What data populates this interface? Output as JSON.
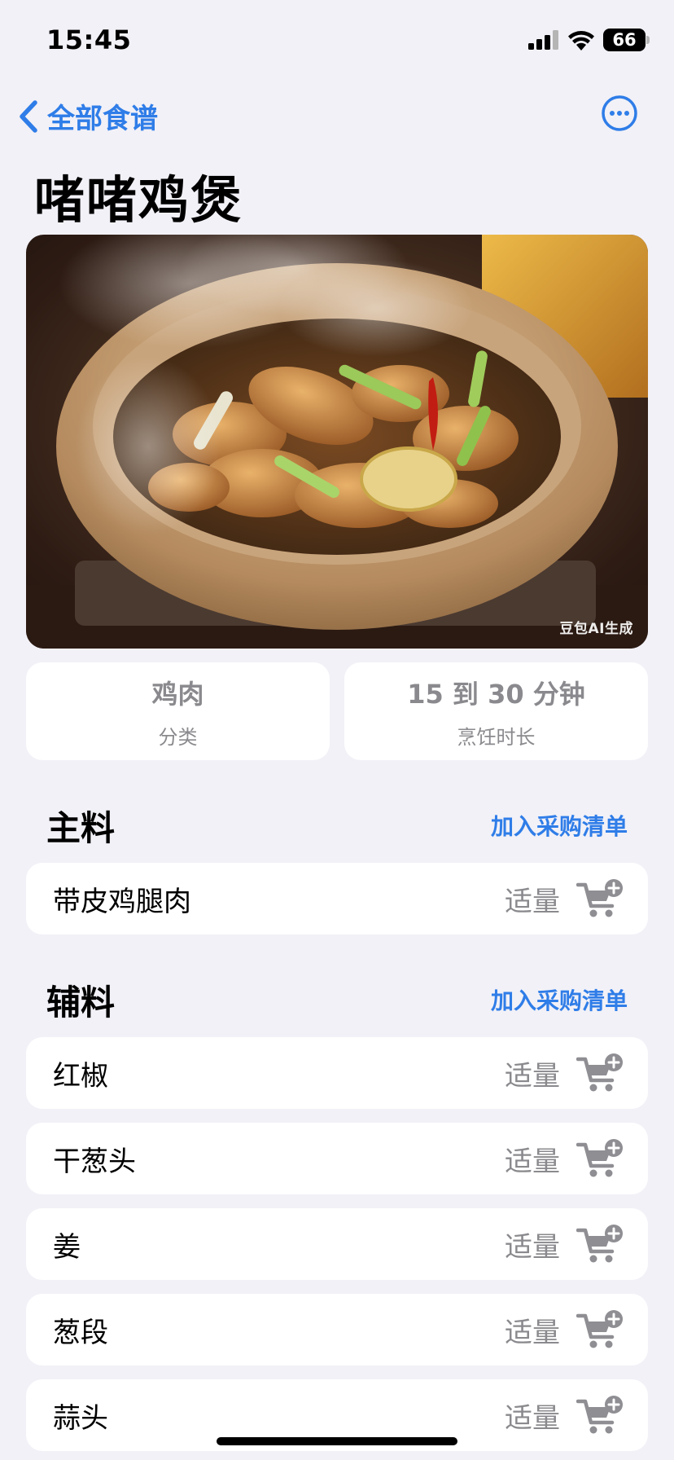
{
  "status": {
    "time": "15:45",
    "battery": "66"
  },
  "nav": {
    "back_label": "全部食谱",
    "back_icon": "chevron-left-icon",
    "more_icon": "ellipsis-circle-icon"
  },
  "recipe": {
    "title": "啫啫鸡煲",
    "image_alt": "clay pot chicken dish with steam",
    "watermark": "豆包AI生成"
  },
  "info": {
    "category_value": "鸡肉",
    "category_label": "分类",
    "time_value": "15 到 30 分钟",
    "time_label": "烹饪时长"
  },
  "main_ingredients": {
    "title": "主料",
    "link": "加入采购清单",
    "items": [
      {
        "name": "带皮鸡腿肉",
        "qty": "适量"
      }
    ]
  },
  "side_ingredients": {
    "title": "辅料",
    "link": "加入采购清单",
    "items": [
      {
        "name": "红椒",
        "qty": "适量"
      },
      {
        "name": "干葱头",
        "qty": "适量"
      },
      {
        "name": "姜",
        "qty": "适量"
      },
      {
        "name": "葱段",
        "qty": "适量"
      },
      {
        "name": "蒜头",
        "qty": "适量"
      }
    ]
  },
  "colors": {
    "accent": "#2f7de8",
    "background": "#f2f1f7",
    "secondary_text": "#8a8a8e"
  }
}
